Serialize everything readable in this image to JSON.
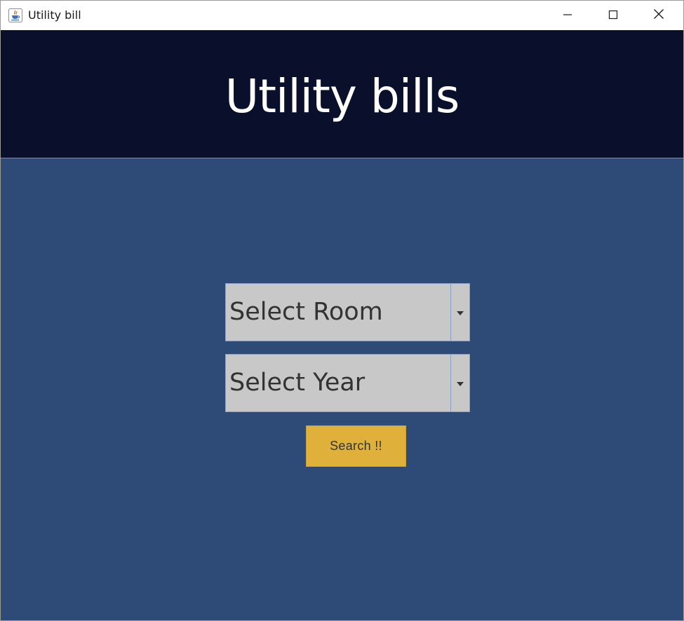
{
  "window": {
    "title": "Utility bill"
  },
  "header": {
    "title": "Utility bills"
  },
  "form": {
    "room_select": {
      "selected": "Select Room"
    },
    "year_select": {
      "selected": "Select Year"
    },
    "search_label": "Search !!"
  },
  "colors": {
    "header_bg": "#0a0f2b",
    "body_bg": "#2e4a76",
    "combo_bg": "#c8c8c8",
    "button_bg": "#dfb13a"
  },
  "icons": {
    "app": "java-app-icon",
    "minimize": "minimize-icon",
    "maximize": "maximize-icon",
    "close": "close-icon",
    "dropdown": "chevron-down-icon"
  }
}
